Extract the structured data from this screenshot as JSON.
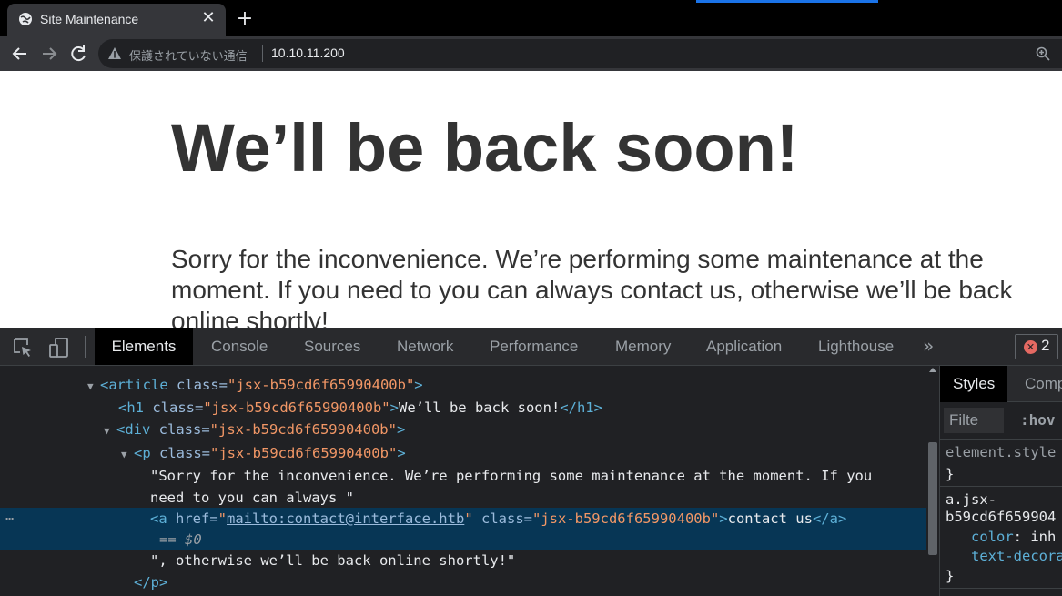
{
  "browser": {
    "tab_title": "Site Maintenance",
    "close_label": "✕",
    "new_tab_label": "+",
    "security_text": "保護されていない通信",
    "url": "10.10.11.200"
  },
  "page": {
    "heading": "We’ll be back soon!",
    "paragraph": "Sorry for the inconvenience. We’re performing some maintenance at the moment. If you need to you can always contact us, otherwise we’ll be back online shortly!"
  },
  "devtools": {
    "tabs": [
      "Elements",
      "Console",
      "Sources",
      "Network",
      "Performance",
      "Memory",
      "Application",
      "Lighthouse"
    ],
    "active_tab": "Elements",
    "more_label": "»",
    "error_count": "2",
    "dom": {
      "article_tag": "<article",
      "class_attr": " class=",
      "class_value": "\"jsx-b59cd6f65990400b\"",
      "close_bracket": ">",
      "h1_open": "<h1",
      "h1_text": "We’ll be back soon!",
      "h1_close": "</h1>",
      "div_open": "<div",
      "p_open": "<p",
      "text1_line1": "\"Sorry for the inconvenience. We’re performing some maintenance at the moment. If you",
      "text1_line2": "need to you can always \"",
      "a_open": "<a",
      "href_attr": " href=",
      "href_value": "mailto:contact@interface.htb",
      "a_text": "contact us",
      "a_close": "</a>",
      "eq_marker": "== $0",
      "text2": "\", otherwise we’ll be back online shortly!\"",
      "p_close": "</p>"
    },
    "styles": {
      "tabs": [
        "Styles",
        "Comp"
      ],
      "filter_placeholder": "Filte",
      "hov_label": ":hov",
      "element_style": "element.style",
      "brace_open": "{",
      "brace_close": "}",
      "selector_line1": "a.jsx-",
      "selector_line2": "b59cd6f659904",
      "prop1_name": "color",
      "prop1_value": "inh",
      "prop2_name": "text-decora"
    }
  }
}
